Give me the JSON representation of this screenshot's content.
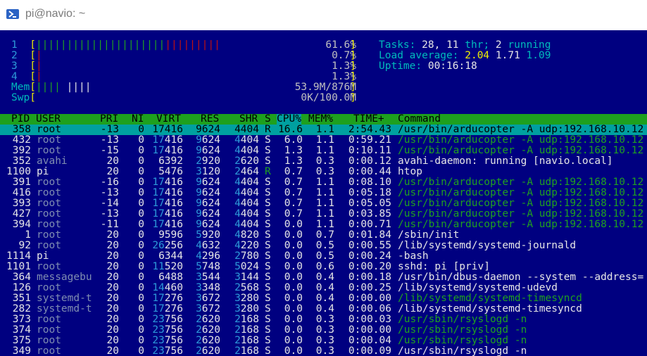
{
  "window": {
    "title": "pi@navio: ~",
    "icon": "powershell-icon"
  },
  "meters": {
    "cpu": [
      {
        "label": "1",
        "pct": "61.6%",
        "level": 0.616
      },
      {
        "label": "2",
        "pct": "0.7%",
        "level": 0.007
      },
      {
        "label": "3",
        "pct": "1.3%",
        "level": 0.013
      },
      {
        "label": "4",
        "pct": "1.3%",
        "level": 0.013
      }
    ],
    "mem": {
      "label": "Mem",
      "value": "53.9M/876M"
    },
    "swp": {
      "label": "Swp",
      "value": "0K/100.0M"
    }
  },
  "stats": {
    "tasks_label": "Tasks:",
    "tasks": "28,",
    "threads": "11",
    "thr_label": "thr;",
    "running": "2",
    "running_label": "running",
    "load_label": "Load average:",
    "load1": "2.04",
    "load5": "1.71",
    "load15": "1.09",
    "uptime_label": "Uptime:",
    "uptime": "00:16:18"
  },
  "columns": [
    "PID",
    "USER",
    "PRI",
    "NI",
    "VIRT",
    "RES",
    "SHR",
    "S",
    "CPU%",
    "MEM%",
    "TIME+",
    "Command"
  ],
  "processes": [
    {
      "pid": "358",
      "user": "root",
      "pri": "-13",
      "ni": "0",
      "virt": "17416",
      "res": "9624",
      "shr": "4404",
      "s": "R",
      "cpu": "16.6",
      "mem": "1.1",
      "time": "2:54.43",
      "cmd": "/usr/bin/arducopter -A udp:192.168.10.12",
      "thread": false,
      "selected": true
    },
    {
      "pid": "432",
      "user": "root",
      "pri": "-13",
      "ni": "0",
      "virt": "17416",
      "res": "9624",
      "shr": "4404",
      "s": "S",
      "cpu": "6.0",
      "mem": "1.1",
      "time": "0:59.21",
      "cmd": "/usr/bin/arducopter -A udp:192.168.10.12",
      "thread": true
    },
    {
      "pid": "392",
      "user": "root",
      "pri": "-15",
      "ni": "0",
      "virt": "17416",
      "res": "9624",
      "shr": "4404",
      "s": "S",
      "cpu": "1.3",
      "mem": "1.1",
      "time": "0:10.11",
      "cmd": "/usr/bin/arducopter -A udp:192.168.10.12",
      "thread": true
    },
    {
      "pid": "352",
      "user": "avahi",
      "pri": "20",
      "ni": "0",
      "virt": "6392",
      "res": "2920",
      "shr": "2620",
      "s": "S",
      "cpu": "1.3",
      "mem": "0.3",
      "time": "0:00.12",
      "cmd": "avahi-daemon: running [navio.local]",
      "thread": false
    },
    {
      "pid": "1100",
      "user": "pi",
      "pri": "20",
      "ni": "0",
      "virt": "5476",
      "res": "3120",
      "shr": "2464",
      "s": "R",
      "cpu": "0.7",
      "mem": "0.3",
      "time": "0:00.44",
      "cmd": "htop",
      "thread": false
    },
    {
      "pid": "391",
      "user": "root",
      "pri": "-16",
      "ni": "0",
      "virt": "17416",
      "res": "9624",
      "shr": "4404",
      "s": "S",
      "cpu": "0.7",
      "mem": "1.1",
      "time": "0:08.10",
      "cmd": "/usr/bin/arducopter -A udp:192.168.10.12",
      "thread": true
    },
    {
      "pid": "416",
      "user": "root",
      "pri": "-13",
      "ni": "0",
      "virt": "17416",
      "res": "9624",
      "shr": "4404",
      "s": "S",
      "cpu": "0.7",
      "mem": "1.1",
      "time": "0:05.18",
      "cmd": "/usr/bin/arducopter -A udp:192.168.10.12",
      "thread": true
    },
    {
      "pid": "393",
      "user": "root",
      "pri": "-14",
      "ni": "0",
      "virt": "17416",
      "res": "9624",
      "shr": "4404",
      "s": "S",
      "cpu": "0.7",
      "mem": "1.1",
      "time": "0:05.05",
      "cmd": "/usr/bin/arducopter -A udp:192.168.10.12",
      "thread": true
    },
    {
      "pid": "427",
      "user": "root",
      "pri": "-13",
      "ni": "0",
      "virt": "17416",
      "res": "9624",
      "shr": "4404",
      "s": "S",
      "cpu": "0.7",
      "mem": "1.1",
      "time": "0:03.85",
      "cmd": "/usr/bin/arducopter -A udp:192.168.10.12",
      "thread": true
    },
    {
      "pid": "394",
      "user": "root",
      "pri": "-11",
      "ni": "0",
      "virt": "17416",
      "res": "9624",
      "shr": "4404",
      "s": "S",
      "cpu": "0.0",
      "mem": "1.1",
      "time": "0:00.71",
      "cmd": "/usr/bin/arducopter -A udp:192.168.10.12",
      "thread": true
    },
    {
      "pid": "1",
      "user": "root",
      "pri": "20",
      "ni": "0",
      "virt": "9596",
      "res": "5920",
      "shr": "4820",
      "s": "S",
      "cpu": "0.0",
      "mem": "0.7",
      "time": "0:01.84",
      "cmd": "/sbin/init",
      "thread": false
    },
    {
      "pid": "92",
      "user": "root",
      "pri": "20",
      "ni": "0",
      "virt": "26256",
      "res": "4632",
      "shr": "4220",
      "s": "S",
      "cpu": "0.0",
      "mem": "0.5",
      "time": "0:00.55",
      "cmd": "/lib/systemd/systemd-journald",
      "thread": false
    },
    {
      "pid": "1114",
      "user": "pi",
      "pri": "20",
      "ni": "0",
      "virt": "6344",
      "res": "4296",
      "shr": "2780",
      "s": "S",
      "cpu": "0.0",
      "mem": "0.5",
      "time": "0:00.24",
      "cmd": "-bash",
      "thread": false
    },
    {
      "pid": "1101",
      "user": "root",
      "pri": "20",
      "ni": "0",
      "virt": "11520",
      "res": "5748",
      "shr": "5024",
      "s": "S",
      "cpu": "0.0",
      "mem": "0.6",
      "time": "0:00.20",
      "cmd": "sshd: pi [priv]",
      "thread": false
    },
    {
      "pid": "364",
      "user": "messagebu",
      "pri": "20",
      "ni": "0",
      "virt": "6488",
      "res": "3544",
      "shr": "3144",
      "s": "S",
      "cpu": "0.0",
      "mem": "0.4",
      "time": "0:00.18",
      "cmd": "/usr/bin/dbus-daemon --system --address=",
      "thread": false
    },
    {
      "pid": "126",
      "user": "root",
      "pri": "20",
      "ni": "0",
      "virt": "14460",
      "res": "3348",
      "shr": "2568",
      "s": "S",
      "cpu": "0.0",
      "mem": "0.4",
      "time": "0:00.25",
      "cmd": "/lib/systemd/systemd-udevd",
      "thread": false
    },
    {
      "pid": "351",
      "user": "systemd-t",
      "pri": "20",
      "ni": "0",
      "virt": "17276",
      "res": "3672",
      "shr": "3280",
      "s": "S",
      "cpu": "0.0",
      "mem": "0.4",
      "time": "0:00.00",
      "cmd": "/lib/systemd/systemd-timesyncd",
      "thread": true
    },
    {
      "pid": "282",
      "user": "systemd-t",
      "pri": "20",
      "ni": "0",
      "virt": "17276",
      "res": "3672",
      "shr": "3280",
      "s": "S",
      "cpu": "0.0",
      "mem": "0.4",
      "time": "0:00.06",
      "cmd": "/lib/systemd/systemd-timesyncd",
      "thread": false
    },
    {
      "pid": "373",
      "user": "root",
      "pri": "20",
      "ni": "0",
      "virt": "23756",
      "res": "2620",
      "shr": "2168",
      "s": "S",
      "cpu": "0.0",
      "mem": "0.3",
      "time": "0:00.03",
      "cmd": "/usr/sbin/rsyslogd -n",
      "thread": true
    },
    {
      "pid": "374",
      "user": "root",
      "pri": "20",
      "ni": "0",
      "virt": "23756",
      "res": "2620",
      "shr": "2168",
      "s": "S",
      "cpu": "0.0",
      "mem": "0.3",
      "time": "0:00.00",
      "cmd": "/usr/sbin/rsyslogd -n",
      "thread": true
    },
    {
      "pid": "375",
      "user": "root",
      "pri": "20",
      "ni": "0",
      "virt": "23756",
      "res": "2620",
      "shr": "2168",
      "s": "S",
      "cpu": "0.0",
      "mem": "0.3",
      "time": "0:00.04",
      "cmd": "/usr/sbin/rsyslogd -n",
      "thread": true
    },
    {
      "pid": "349",
      "user": "root",
      "pri": "20",
      "ni": "0",
      "virt": "23756",
      "res": "2620",
      "shr": "2168",
      "s": "S",
      "cpu": "0.0",
      "mem": "0.3",
      "time": "0:00.09",
      "cmd": "/usr/sbin/rsyslogd -n",
      "thread": false
    }
  ],
  "colors": {
    "header_bg": "#1ea01e",
    "selected_bg": "#00a0a0",
    "background": "#000080"
  }
}
